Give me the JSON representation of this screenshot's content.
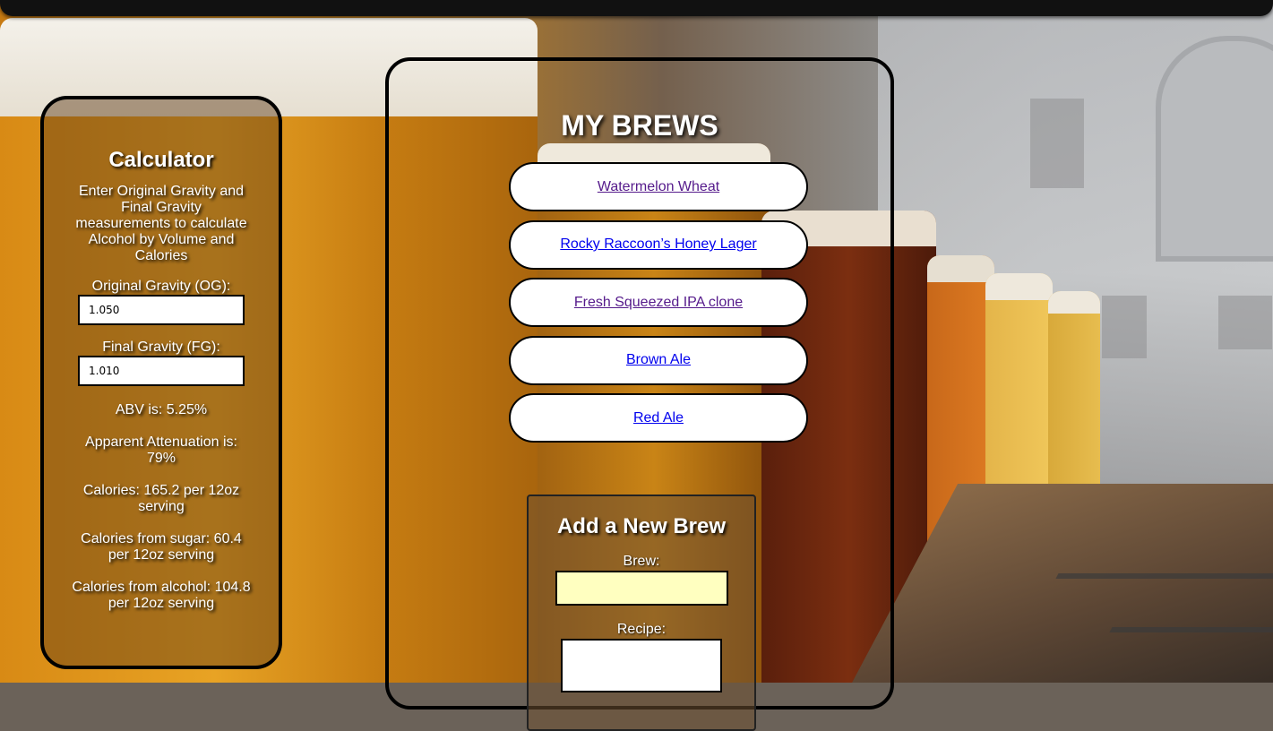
{
  "calculator": {
    "title": "Calculator",
    "intro": "Enter Original Gravity and Final Gravity measurements to calculate Alcohol by Volume and Calories",
    "og_label": "Original Gravity (OG):",
    "og_value": "1.050",
    "fg_label": "Final Gravity (FG):",
    "fg_value": "1.010",
    "abv": "ABV is: 5.25%",
    "attenuation": "Apparent Attenuation is: 79%",
    "calories": "Calories: 165.2 per 12oz serving",
    "calories_sugar": "Calories from sugar: 60.4 per 12oz serving",
    "calories_alcohol": "Calories from alcohol: 104.8 per 12oz serving"
  },
  "brews": {
    "title": "MY BREWS",
    "items": [
      {
        "label": "Watermelon Wheat",
        "visited": true
      },
      {
        "label": "Rocky Raccoon’s Honey Lager",
        "visited": false
      },
      {
        "label": "Fresh Squeezed IPA clone",
        "visited": true
      },
      {
        "label": "Brown Ale",
        "visited": false
      },
      {
        "label": "Red Ale",
        "visited": false
      }
    ]
  },
  "add_brew": {
    "title": "Add a New Brew",
    "brew_label": "Brew:",
    "brew_value": "",
    "recipe_label": "Recipe:",
    "recipe_value": ""
  },
  "colors": {
    "visited_link": "#551a8b",
    "unvisited_link": "#0000ee",
    "brew_input_bg": "#ffffc0"
  }
}
